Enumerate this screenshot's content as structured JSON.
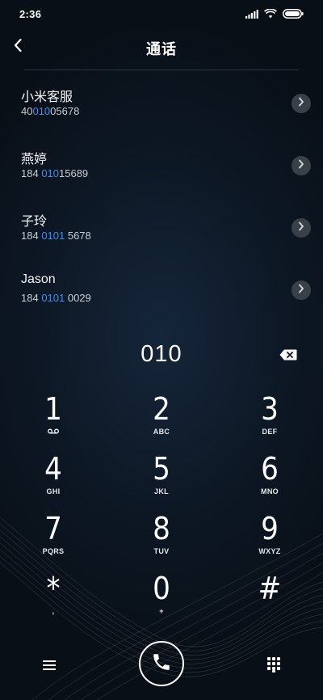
{
  "status": {
    "time": "2:36"
  },
  "header": {
    "title": "通话"
  },
  "results": [
    {
      "name": "小米客服",
      "num_pre": "40",
      "num_hl": "010",
      "num_post": "05678"
    },
    {
      "name": "燕婷",
      "num_pre": "184 ",
      "num_hl": "010",
      "num_post": "15689"
    },
    {
      "name": "子玲",
      "num_pre": "184 ",
      "num_hl": "0101",
      "num_post": " 5678"
    },
    {
      "name": "Jason",
      "num_pre": "184 ",
      "num_hl": "0101",
      "num_post": " 0029"
    }
  ],
  "dialer": {
    "digits": "010"
  },
  "keypad": [
    {
      "digit": "1",
      "letters": ""
    },
    {
      "digit": "2",
      "letters": "ABC"
    },
    {
      "digit": "3",
      "letters": "DEF"
    },
    {
      "digit": "4",
      "letters": "GHI"
    },
    {
      "digit": "5",
      "letters": "JKL"
    },
    {
      "digit": "6",
      "letters": "MNO"
    },
    {
      "digit": "7",
      "letters": "PQRS"
    },
    {
      "digit": "8",
      "letters": "TUV"
    },
    {
      "digit": "9",
      "letters": "WXYZ"
    },
    {
      "digit": "*",
      "letters": ","
    },
    {
      "digit": "0",
      "letters": "+"
    },
    {
      "digit": "#",
      "letters": ""
    }
  ],
  "icons": {
    "back": "chevron-left-icon",
    "detail": "chevron-right-icon",
    "delete": "backspace-icon",
    "voicemail": "voicemail-icon",
    "menu": "hamburger-menu-icon",
    "call": "phone-icon",
    "keypad_toggle": "dialpad-icon",
    "signal": "signal-icon",
    "wifi": "wifi-icon",
    "battery": "battery-icon"
  },
  "colors": {
    "highlight": "#3b8ef0",
    "background": "#0d1825",
    "detail_button": "#3a4047"
  }
}
